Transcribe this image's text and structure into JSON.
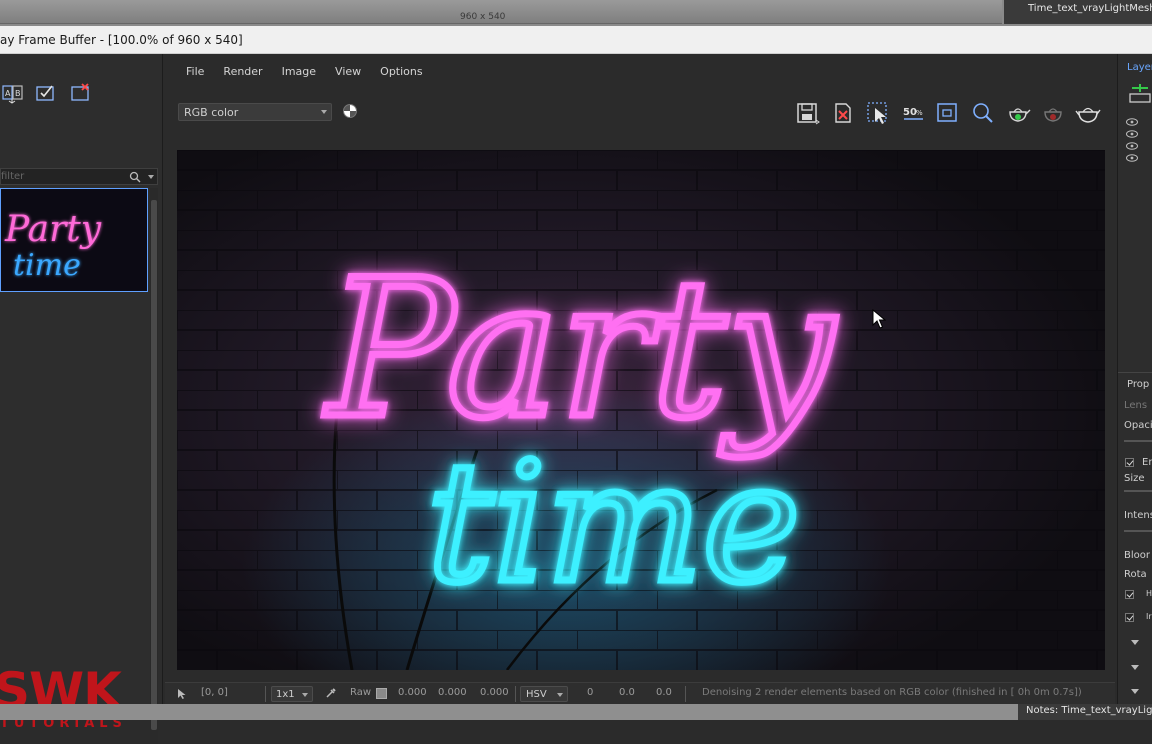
{
  "background_app": {
    "size_label": "960 x 540",
    "object_name": "Time_text_vrayLightMesh"
  },
  "window": {
    "title": "ay Frame Buffer - [100.0% of 960 x 540]"
  },
  "left_panel": {
    "filter_placeholder": "filter",
    "thumbnail_line1": "Party",
    "thumbnail_line2": "time",
    "brand_main": "SWK",
    "brand_sub": "TUTORIALS"
  },
  "menu": {
    "items": [
      "File",
      "Render",
      "Image",
      "View",
      "Options"
    ]
  },
  "toolbar": {
    "channel_selected": "RGB color"
  },
  "render": {
    "line1": "Party",
    "line2": "time"
  },
  "status_bar": {
    "coords": "[0, 0]",
    "zoom": "1x1",
    "raw_label": "Raw",
    "raw_values": [
      "0.000",
      "0.000",
      "0.000"
    ],
    "color_mode": "HSV",
    "hsv_values": [
      "0",
      "0.0",
      "0.0"
    ],
    "message": "Denoising 2 render elements based on RGB color (finished in [ 0h  0m  0.7s])"
  },
  "right_panel": {
    "layers_label": "Layer",
    "properties_label": "Prop",
    "lens_label": "Lens",
    "opacity_label": "Opaci",
    "enable_label": "En",
    "size_label": "Size",
    "intensity_label": "Intens",
    "bloom_label": "Bloor",
    "rotation_label": "Rota",
    "check_h": "H",
    "check_i": "Ir"
  },
  "bottom": {
    "notes": "Notes: Time_text_vrayLigh"
  },
  "colors": {
    "neon_pink": "#ff4df0",
    "neon_cyan": "#29e8ff",
    "accent_blue": "#5fa0ff",
    "brand_red": "#c0151b"
  }
}
